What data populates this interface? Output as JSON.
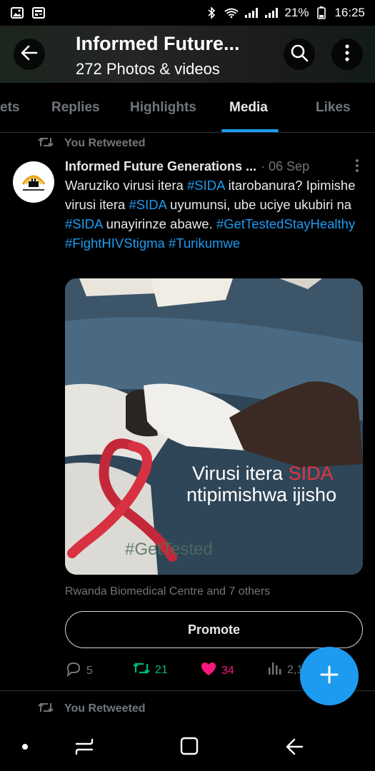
{
  "status_bar": {
    "battery": "21%",
    "time": "16:25",
    "left_icons": [
      "image-icon",
      "news-icon"
    ],
    "right_icons": [
      "bluetooth-icon",
      "wifi-icon",
      "signal-icon",
      "signal-icon",
      "battery-icon"
    ]
  },
  "header": {
    "title": "Informed Future...",
    "subtitle": "272 Photos & videos",
    "icons": [
      "back-arrow-icon",
      "search-icon",
      "more-vertical-icon"
    ]
  },
  "tabs": [
    {
      "label": "ets",
      "active": false
    },
    {
      "label": "Replies",
      "active": false
    },
    {
      "label": "Highlights",
      "active": false
    },
    {
      "label": "Media",
      "active": true
    },
    {
      "label": "Likes",
      "active": false
    }
  ],
  "tweet": {
    "retweet_label": "You Retweeted",
    "author": "Informed Future Generations ...",
    "date": "· 06 Sep",
    "text_segments": [
      {
        "t": "Waruziko virusi itera ",
        "h": false
      },
      {
        "t": "#SIDA",
        "h": true
      },
      {
        "t": " itarobanura? Ipimishe virusi itera ",
        "h": false
      },
      {
        "t": "#SIDA",
        "h": true
      },
      {
        "t": "  uyumunsi, ube uciye ukubiri na ",
        "h": false
      },
      {
        "t": "#SIDA",
        "h": true
      },
      {
        "t": " unayirinze abawe. ",
        "h": false
      },
      {
        "t": "#GetTestedStayHealthy",
        "h": true
      },
      {
        "t": " ",
        "h": false
      },
      {
        "t": "#FightHIVStigma",
        "h": true
      },
      {
        "t": " ",
        "h": false
      },
      {
        "t": "#Turikumwe",
        "h": true
      }
    ],
    "media": {
      "line1_white": "Virusi itera ",
      "line1_red": "SIDA",
      "line2": "ntipimishwa ijisho",
      "watermark": "#GetTested"
    },
    "tagged": "Rwanda Biomedical Centre and 7 others",
    "promote_label": "Promote",
    "replies": "5",
    "retweets": "21",
    "likes": "34",
    "views": "2,1"
  },
  "next_tweet": {
    "retweet_label": "You Retweeted"
  },
  "colors": {
    "accent": "#1d9bf0",
    "retweet_green": "#00ba7c",
    "like_pink": "#f91880",
    "muted": "#71767b",
    "sida_red": "#e5343f"
  }
}
